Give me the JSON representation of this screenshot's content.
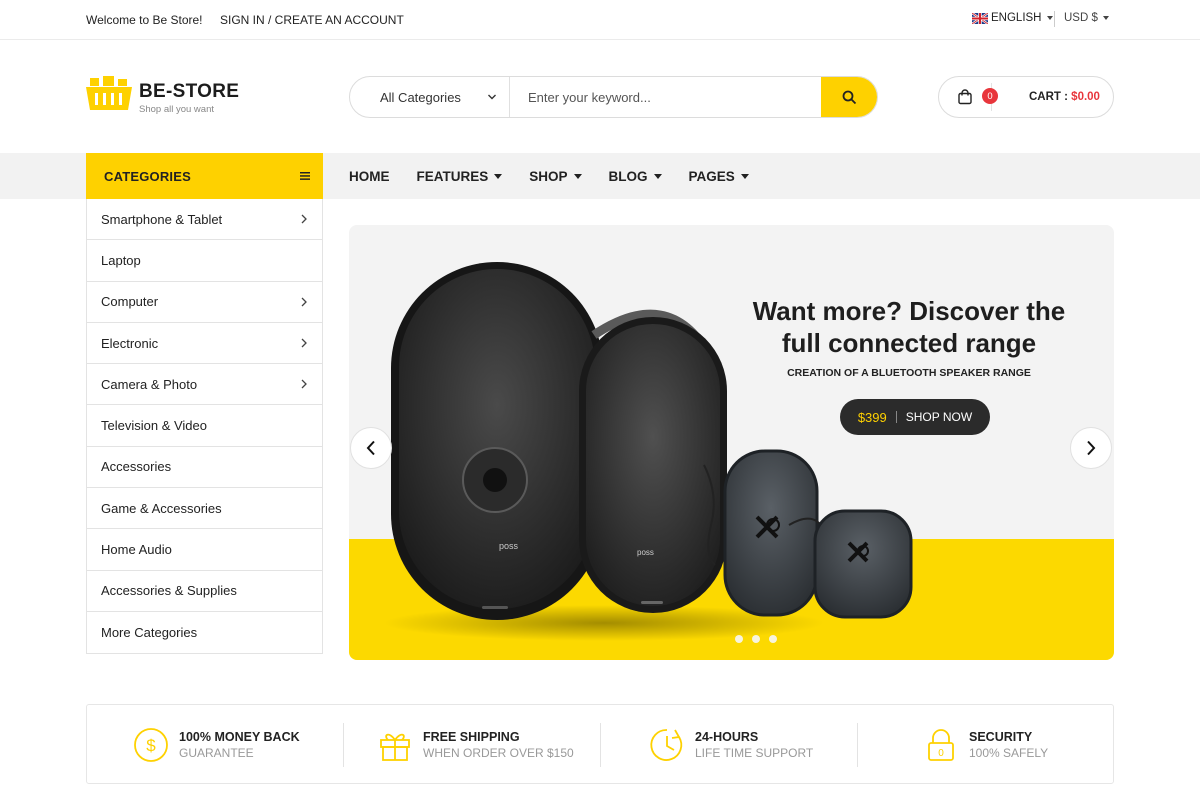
{
  "topbar": {
    "welcome": "Welcome to Be Store!",
    "signin": "SIGN IN / CREATE AN ACCOUNT",
    "language": "ENGLISH",
    "currency": "USD $"
  },
  "header": {
    "logo_name": "BE-STORE",
    "logo_tagline": "Shop all you want",
    "search_category": "All Categories",
    "search_placeholder": "Enter your keyword...",
    "cart_count": "0",
    "cart_label": "CART :",
    "cart_amount": "$0.00"
  },
  "nav": {
    "categories_title": "CATEGORIES",
    "items": [
      {
        "label": "HOME",
        "dropdown": false
      },
      {
        "label": "FEATURES",
        "dropdown": true
      },
      {
        "label": "SHOP",
        "dropdown": true
      },
      {
        "label": "BLOG",
        "dropdown": true
      },
      {
        "label": "PAGES",
        "dropdown": true
      }
    ]
  },
  "categories": [
    {
      "label": "Smartphone & Tablet",
      "arrow": true
    },
    {
      "label": "Laptop",
      "arrow": false
    },
    {
      "label": "Computer",
      "arrow": true
    },
    {
      "label": "Electronic",
      "arrow": true
    },
    {
      "label": "Camera & Photo",
      "arrow": true
    },
    {
      "label": "Television & Video",
      "arrow": false
    },
    {
      "label": "Accessories",
      "arrow": false
    },
    {
      "label": "Game & Accessories",
      "arrow": false
    },
    {
      "label": "Home Audio",
      "arrow": false
    },
    {
      "label": "Accessories & Supplies",
      "arrow": false
    },
    {
      "label": "More Categories",
      "arrow": false
    }
  ],
  "slider": {
    "title": "Want more? Discover the full connected range",
    "subtitle": "CREATION OF A BLUETOOTH SPEAKER RANGE",
    "price": "$399",
    "cta": "SHOP NOW",
    "brand_mark": "poss",
    "dot_count": 3,
    "accent": "#fcd900"
  },
  "features": [
    {
      "icon": "money-icon",
      "title": "100% MONEY BACK",
      "subtitle": "GUARANTEE"
    },
    {
      "icon": "gift-icon",
      "title": "FREE SHIPPING",
      "subtitle": "WHEN ORDER OVER $150"
    },
    {
      "icon": "clock-icon",
      "title": "24-HOURS",
      "subtitle": "LIFE TIME SUPPORT"
    },
    {
      "icon": "lock-icon",
      "title": "SECURITY",
      "subtitle": "100% SAFELY"
    }
  ],
  "colors": {
    "brand_yellow": "#fed100",
    "cart_red": "#e8363c",
    "dark": "#2b2b2b"
  }
}
